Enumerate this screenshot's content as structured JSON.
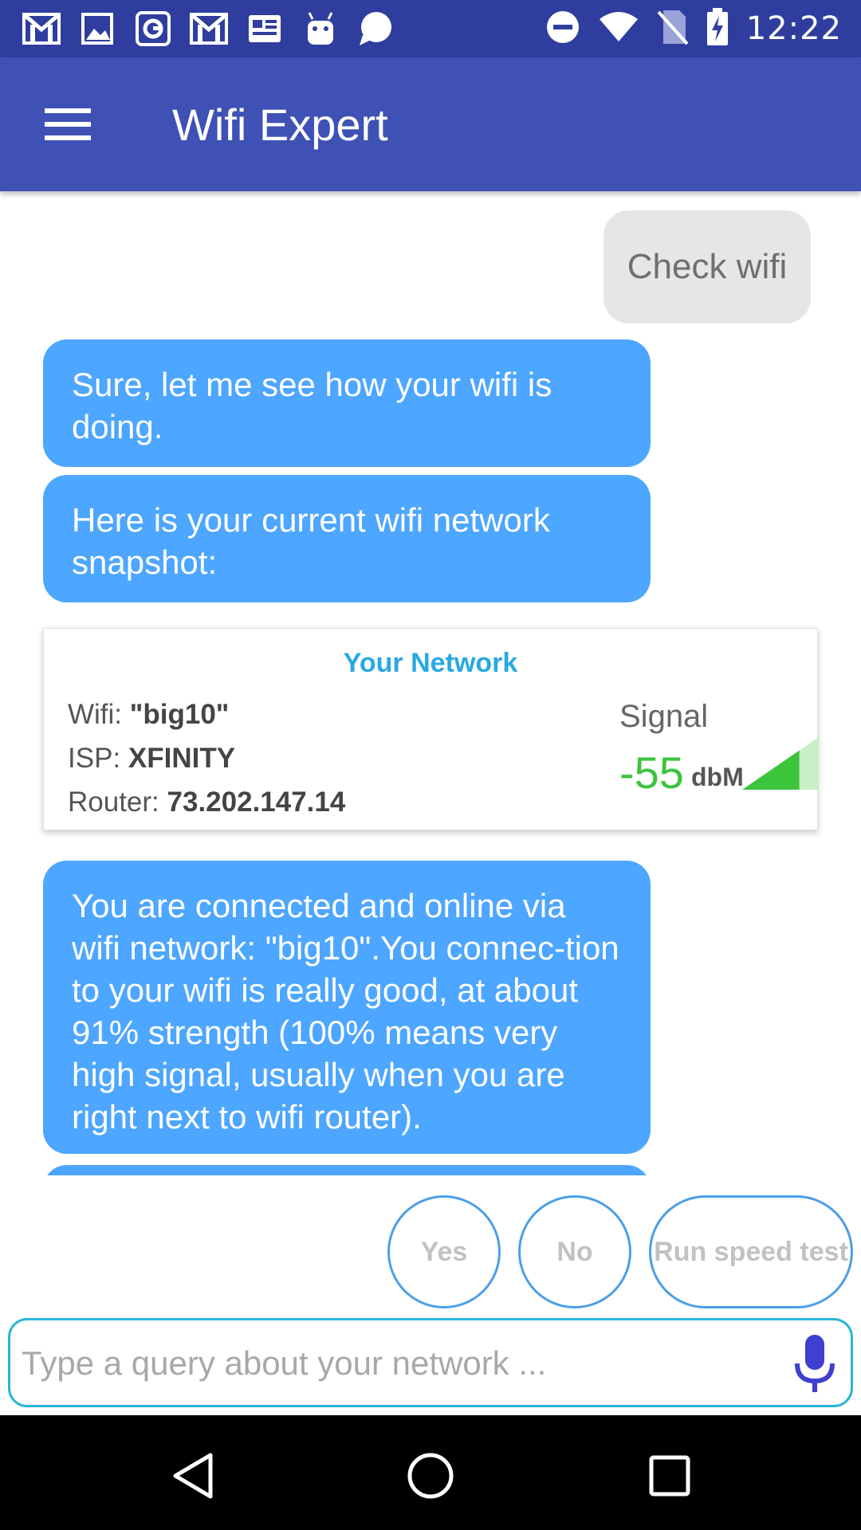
{
  "status_bar": {
    "time": "12:22",
    "left_icons": [
      "gmail-icon",
      "image-icon",
      "google-icon",
      "gmail-icon",
      "news-icon",
      "android-icon",
      "chat-bubble-icon"
    ],
    "right_icons": [
      "do-not-disturb-icon",
      "wifi-icon",
      "no-sim-icon",
      "battery-charging-icon"
    ]
  },
  "app_bar": {
    "title": "Wifi Expert",
    "menu_icon": "hamburger-menu-icon"
  },
  "chat": {
    "user_message": "Check wifi",
    "bot_messages": [
      "Sure, let me see how your wifi is doing.",
      "Here is your current wifi network snapshot:",
      "You are connected and online via wifi network: \"big10\".You connec-tion to your wifi is really good, at about 91% strength (100% means very high signal, usually when you are right next to wifi router)."
    ]
  },
  "network_card": {
    "title": "Your Network",
    "wifi_label": "Wifi:",
    "wifi_value": "\"big10\"",
    "isp_label": "ISP:",
    "isp_value": "XFINITY",
    "router_label": "Router:",
    "router_value": "73.202.147.14",
    "signal_label": "Signal",
    "signal_value": "-55",
    "signal_unit": "dbM",
    "signal_strength": 0.91
  },
  "quick_replies": {
    "yes": "Yes",
    "no": "No",
    "speed_test": "Run speed test"
  },
  "input": {
    "placeholder": "Type a query about your network ...",
    "value": "",
    "mic_icon": "microphone-icon"
  },
  "colors": {
    "status_bar": "#2f3e9e",
    "app_bar": "#3f51b5",
    "bot_bubble": "#4da6ff",
    "user_bubble": "#e6e6e6",
    "card_title": "#29a9e0",
    "signal_green": "#3cc43c",
    "chip_border": "#4a9fe8",
    "mic": "#3f3fd0"
  }
}
